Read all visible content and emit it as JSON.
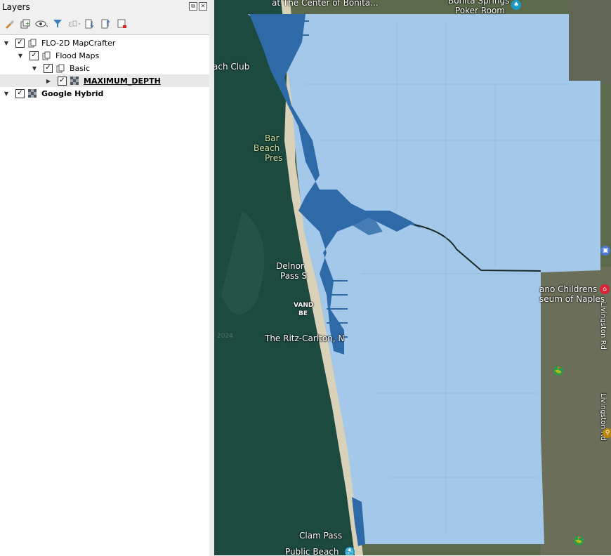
{
  "panel": {
    "title": "Layers",
    "float_btn": "⧉",
    "close_btn": "✕",
    "toolbar": [
      {
        "name": "style-brush-icon"
      },
      {
        "name": "add-group-icon"
      },
      {
        "name": "eye-icon"
      },
      {
        "name": "filter-icon"
      },
      {
        "name": "filter-expression-icon"
      },
      {
        "name": "expand-all-icon"
      },
      {
        "name": "collapse-all-icon"
      },
      {
        "name": "remove-layer-icon"
      }
    ]
  },
  "layers": [
    {
      "label": "FLO-2D MapCrafter",
      "checked": true,
      "expanded": true,
      "type": "group"
    },
    {
      "label": "Flood Maps",
      "checked": true,
      "expanded": true,
      "type": "group"
    },
    {
      "label": "Basic",
      "checked": true,
      "expanded": true,
      "type": "group"
    },
    {
      "label": "MAXIMUM_DEPTH",
      "checked": true,
      "expanded": false,
      "type": "raster"
    },
    {
      "label": "Google Hybrid",
      "checked": true,
      "expanded": true,
      "type": "raster"
    }
  ],
  "map": {
    "labels": {
      "center_bonita": "at The Center of Bonita...",
      "bonita_springs": "Bonita Springs",
      "poker_room": "Poker Room",
      "beach_club": "ach Club",
      "barefoot_1": "Bar",
      "barefoot_2": "Beach",
      "barefoot_3": "Pres",
      "delnor_1": "Delnor",
      "delnor_2": "Pass S",
      "vanderbilt_1": "VAND",
      "vanderbilt_2": "BE",
      "ritz": "The Ritz-Carlton, N",
      "clam_pass": "Clam Pass",
      "public_beach": "Public Beach",
      "childrens_1": "ano Childrens",
      "childrens_2": "seum of Naples",
      "livingston_1": "Livingston Rd",
      "livingston_2": "Livingston Rd",
      "year_mark": "2024"
    },
    "colors": {
      "flood_light": "#a3c8ea",
      "flood_dark": "#2f6aa8",
      "water": "#1d4a3f"
    }
  }
}
